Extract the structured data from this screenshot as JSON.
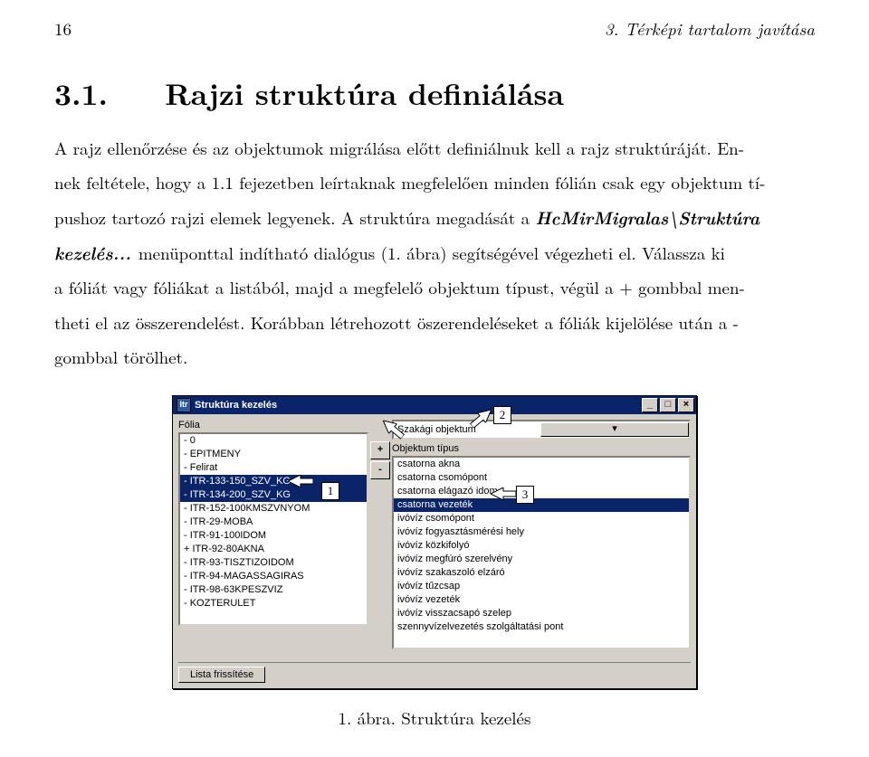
{
  "running_head": {
    "page": "16",
    "chapter": "3. Térképi tartalom javítása"
  },
  "section": {
    "number": "3.1.",
    "title": "Rajzi struktúra definiálása"
  },
  "paragraph": {
    "p1a": "A rajz ellenőrzése és az objektumok migrálása előtt definiálnuk kell a rajz struktúráját. En-",
    "p1b": "nek feltétele, hogy a 1.1 fejezetben leírtaknak megfelelően minden fólián csak egy objektum tí-",
    "p1c": "pushoz tartozó rajzi elemek legyenek. A struktúra megadását a ",
    "p1c_bi": "HcMirMigralas\\Struktúra",
    "p1d_bi": "kezelés... ",
    "p1d": "menüponttal indítható dialógus (1. ábra) segítségével végezheti el. Válassza ki",
    "p1e": "a fóliát vagy fóliákat a listából, majd a megfelelő objektum típust, végül a + gombbal men-",
    "p1f": "theti el az összerendelést. Korábban létrehozott öszerendeléseket a fóliák kijelölése után a -",
    "p1g": "gombbal törölhet."
  },
  "dialog": {
    "title": "Struktúra kezelés",
    "sysicon": "Itr",
    "min": "_",
    "max": "□",
    "close": "×",
    "folia_label": "Fólia",
    "combo_label": "Szakági objektum",
    "combo_arrow": "▾",
    "objtype_label": "Objektum típus",
    "plus": "+",
    "minus": "-",
    "folia_items": [
      "- 0",
      "- EPITMENY",
      "- Felirat",
      "- ITR-133-150_SZV_KG",
      "- ITR-134-200_SZV_KG",
      "- ITR-152-100KMSZVNYOM",
      "- ITR-29-MOBA",
      "- ITR-91-100IDOM",
      "+ ITR-92-80AKNA",
      "- ITR-93-TISZTIZOIDOM",
      "- ITR-94-MAGASSAGIRAS",
      "- ITR-98-63KPESZVIZ",
      "- KOZTERULET"
    ],
    "folia_selected": [
      3,
      4
    ],
    "obj_items": [
      "csatorna akna",
      "csatorna csomópont",
      "csatorna elágazó idom",
      "csatorna vezeték",
      "ivóvíz csomópont",
      "ivóvíz fogyasztásmérési hely",
      "ivóvíz közkifolyó",
      "ivóvíz megfúró szerelvény",
      "ivóvíz szakaszoló elzáró",
      "ivóvíz tűzcsap",
      "ivóvíz vezeték",
      "ivóvíz visszacsapó szelep",
      "szennyvízelvezetés szolgáltatási pont"
    ],
    "obj_selected": [
      3
    ],
    "footer_btn": "Lista frissítése"
  },
  "markers": {
    "m1": "1",
    "m2": "2",
    "m3": "3"
  },
  "caption": "1. ábra. Struktúra kezelés"
}
